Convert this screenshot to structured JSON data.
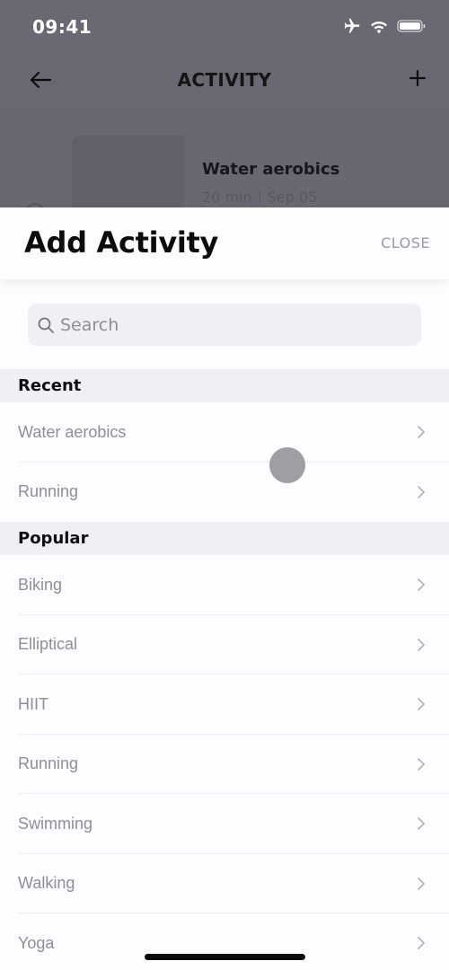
{
  "status_bar": {
    "time": "09:41",
    "icons": [
      "airplane-mode-icon",
      "wifi-icon",
      "battery-icon"
    ]
  },
  "nav": {
    "back_icon": "arrow-left-icon",
    "title": "ACTIVITY",
    "add_icon": "plus-icon"
  },
  "background_card": {
    "title": "Water aerobics",
    "duration": "20 min",
    "date": "Sep 05"
  },
  "sheet": {
    "title": "Add Activity",
    "close_label": "CLOSE",
    "search": {
      "placeholder": "Search",
      "value": ""
    },
    "sections": [
      {
        "header": "Recent",
        "items": [
          {
            "label": "Water aerobics"
          },
          {
            "label": "Running"
          }
        ]
      },
      {
        "header": "Popular",
        "items": [
          {
            "label": "Biking"
          },
          {
            "label": "Elliptical"
          },
          {
            "label": "HIIT"
          },
          {
            "label": "Running"
          },
          {
            "label": "Swimming"
          },
          {
            "label": "Walking"
          },
          {
            "label": "Yoga"
          }
        ]
      }
    ]
  },
  "colors": {
    "overlay_dim": "#6a6973",
    "section_bg": "#eef0f4",
    "list_text": "#8f8e96",
    "close_text": "#9b9aa2"
  }
}
